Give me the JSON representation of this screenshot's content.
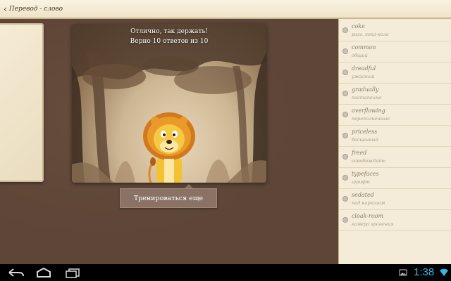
{
  "header": {
    "back_glyph": "‹",
    "title": "Перевод - слово"
  },
  "result": {
    "line1": "Отлично, так держать!",
    "line2": "Верно 10 ответов из 10",
    "train_button": "Тренироваться еще"
  },
  "words": [
    {
      "en": "coke",
      "ru": "разг. кока-кола"
    },
    {
      "en": "common",
      "ru": "общий"
    },
    {
      "en": "dreadful",
      "ru": "ужасный"
    },
    {
      "en": "gradually",
      "ru": "постепенно"
    },
    {
      "en": "overflowing",
      "ru": "переполненные"
    },
    {
      "en": "priceless",
      "ru": "бесценный"
    },
    {
      "en": "freed",
      "ru": "освобождать"
    },
    {
      "en": "typefaces",
      "ru": "шрифт"
    },
    {
      "en": "sedated",
      "ru": "под наркозом"
    },
    {
      "en": "cloak-room",
      "ru": "камера хранения"
    }
  ],
  "system": {
    "time": "1:38",
    "icons": [
      "back-icon",
      "home-icon",
      "recent-apps-icon",
      "gallery-icon",
      "wifi-icon"
    ]
  },
  "colors": {
    "clock": "#33b5e5",
    "panel": "#f4ecd8",
    "background": "#5a4235",
    "button": "#8a7364"
  }
}
